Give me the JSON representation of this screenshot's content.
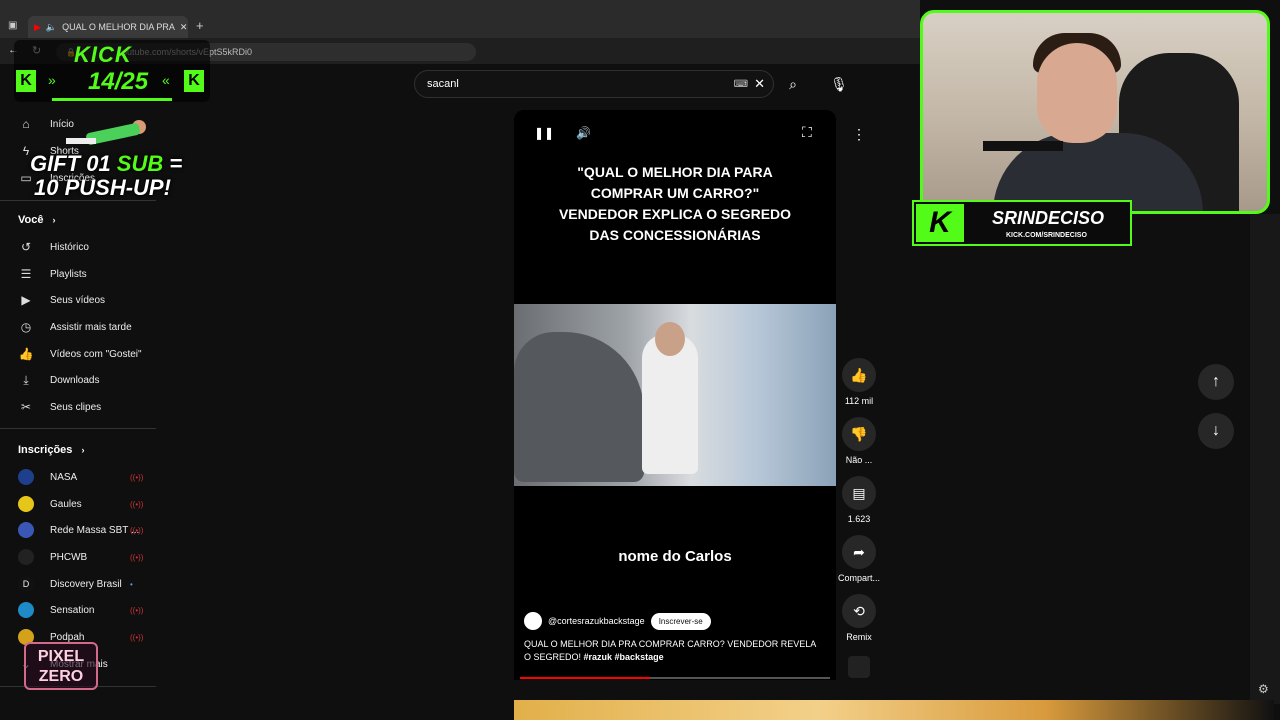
{
  "browser": {
    "tab_title": "QUAL O MELHOR DIA PRA",
    "url": "outube.com/shorts/vEptS5kRDi0"
  },
  "search": {
    "query": "sacanl"
  },
  "sidebar": {
    "items": [
      {
        "label": "Início",
        "icon": "home-icon"
      },
      {
        "label": "Shorts",
        "icon": "shorts-icon"
      },
      {
        "label": "Inscrições",
        "icon": "subscriptions-icon"
      }
    ],
    "voce_title": "Você",
    "voce_items": [
      {
        "label": "Histórico",
        "icon": "history-icon"
      },
      {
        "label": "Playlists",
        "icon": "playlist-icon"
      },
      {
        "label": "Seus vídeos",
        "icon": "video-icon"
      },
      {
        "label": "Assistir mais tarde",
        "icon": "clock-icon"
      },
      {
        "label": "Vídeos com \"Gostei\"",
        "icon": "thumb-up-icon"
      },
      {
        "label": "Downloads",
        "icon": "download-icon"
      },
      {
        "label": "Seus clipes",
        "icon": "scissors-icon"
      }
    ],
    "subs_title": "Inscrições",
    "subs": [
      {
        "label": "NASA",
        "color": "#1d3f8c"
      },
      {
        "label": "Gaules",
        "color": "#e7c61a"
      },
      {
        "label": "Rede Massa SBT ...",
        "color": "#3b57b5"
      },
      {
        "label": "PHCWB",
        "color": "#222222"
      },
      {
        "label": "Discovery Brasil",
        "color": "#111111"
      },
      {
        "label": "Sensation",
        "color": "#1e8ac7"
      },
      {
        "label": "Podpah",
        "color": "#d4a21a"
      }
    ],
    "more_label": "Mostrar mais"
  },
  "video": {
    "title": "\"QUAL O MELHOR DIA PARA\nCOMPRAR UM CARRO?\"\nVENDEDOR EXPLICA O SEGREDO\nDAS CONCESSIONÁRIAS",
    "caption": "nome do Carlos",
    "channel": "@cortesrazukbackstage",
    "subscribe_label": "Inscrever-se",
    "description": "QUAL O MELHOR DIA PRA COMPRAR CARRO? VENDEDOR REVELA O SEGREDO!",
    "hashtags": "#razuk #backstage",
    "progress": 0.42
  },
  "actions": {
    "likes": "112 mil",
    "dislike": "Não ...",
    "comments": "1.623",
    "share": "Compart...",
    "remix": "Remix"
  },
  "overlay": {
    "kick_logo": "KICK",
    "kick_count": "14/25",
    "gift_line1_a": "GIFT 01 ",
    "gift_line1_b": "SUB",
    "gift_line1_c": " =",
    "gift_line2": "10 PUSH-UP!",
    "pixel_logo_1": "PIXEL",
    "pixel_logo_2": "ZERO",
    "streamer_name": "SRINDECISO",
    "streamer_url": "KICK.COM/SRINDECISO",
    "kick_green": "#53fc18"
  }
}
